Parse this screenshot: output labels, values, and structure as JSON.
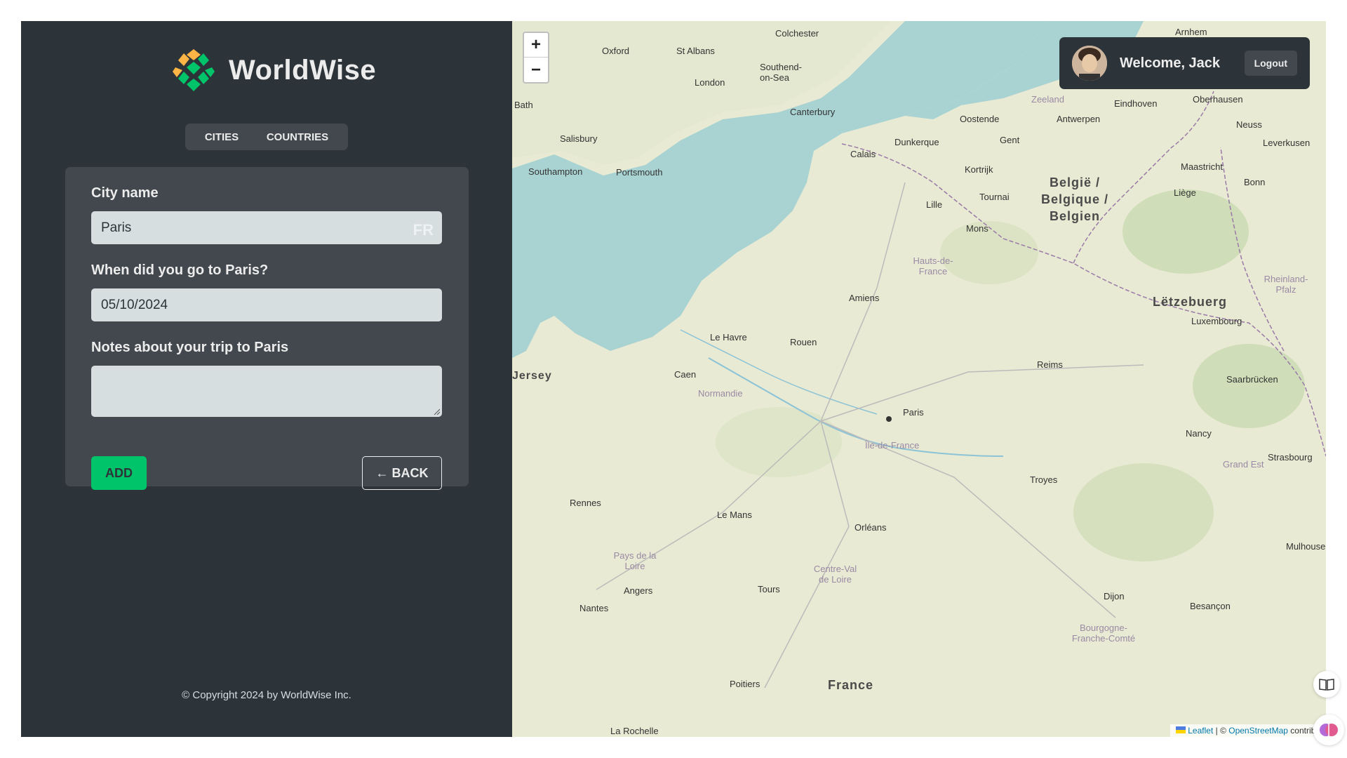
{
  "app": {
    "logo_text": "WorldWise",
    "tabs": [
      {
        "label": "Cities"
      },
      {
        "label": "Countries"
      }
    ],
    "copyright": "© Copyright 2024 by WorldWise Inc."
  },
  "form": {
    "city_label": "City name",
    "city_value": "Paris",
    "city_flag": "FR",
    "date_label": "When did you go to Paris?",
    "date_value": "05/10/2024",
    "notes_label": "Notes about your trip to Paris",
    "notes_value": "",
    "add_label": "Add",
    "back_label": "← BACK"
  },
  "map": {
    "zoom_in": "+",
    "zoom_out": "−",
    "user": {
      "welcome": "Welcome, Jack",
      "logout": "Logout"
    },
    "attribution": {
      "leaflet": "Leaflet",
      "sep": " | © ",
      "osm": "OpenStreetMap",
      "rest": " contribu"
    },
    "labels": [
      {
        "text": "Colchester",
        "type": "city"
      },
      {
        "text": "Oxford",
        "type": "city"
      },
      {
        "text": "St Albans",
        "type": "city"
      },
      {
        "text": "London",
        "type": "city"
      },
      {
        "text": "Southend-on-Sea",
        "type": "city"
      },
      {
        "text": "Canterbury",
        "type": "city"
      },
      {
        "text": "Bath",
        "type": "city"
      },
      {
        "text": "Salisbury",
        "type": "city"
      },
      {
        "text": "Southampton",
        "type": "city"
      },
      {
        "text": "Portsmouth",
        "type": "city"
      },
      {
        "text": "Calais",
        "type": "city"
      },
      {
        "text": "Dunkerque",
        "type": "city"
      },
      {
        "text": "Oostende",
        "type": "city"
      },
      {
        "text": "Gent",
        "type": "city"
      },
      {
        "text": "Antwerpen",
        "type": "city"
      },
      {
        "text": "Eindhoven",
        "type": "city"
      },
      {
        "text": "Kortrijk",
        "type": "city"
      },
      {
        "text": "Lille",
        "type": "city"
      },
      {
        "text": "Tournai",
        "type": "city"
      },
      {
        "text": "Mons",
        "type": "city"
      },
      {
        "text": "België / Belgique / Belgien",
        "type": "country"
      },
      {
        "text": "Maastricht",
        "type": "city"
      },
      {
        "text": "Liège",
        "type": "city"
      },
      {
        "text": "Bonn",
        "type": "city"
      },
      {
        "text": "Neuss",
        "type": "city"
      },
      {
        "text": "Leverkusen",
        "type": "city"
      },
      {
        "text": "Oberhausen",
        "type": "city"
      },
      {
        "text": "Arnhem",
        "type": "city"
      },
      {
        "text": "Lëtzebuerg",
        "type": "country"
      },
      {
        "text": "Luxembourg",
        "type": "city"
      },
      {
        "text": "Hauts-de-France",
        "type": "region"
      },
      {
        "text": "Amiens",
        "type": "city"
      },
      {
        "text": "Le Havre",
        "type": "city"
      },
      {
        "text": "Rouen",
        "type": "city"
      },
      {
        "text": "Caen",
        "type": "city"
      },
      {
        "text": "Normandie",
        "type": "region"
      },
      {
        "text": "Reims",
        "type": "city"
      },
      {
        "text": "Paris",
        "type": "city"
      },
      {
        "text": "Île-de-France",
        "type": "region"
      },
      {
        "text": "Saarbrücken",
        "type": "city"
      },
      {
        "text": "Nancy",
        "type": "city"
      },
      {
        "text": "Strasbourg",
        "type": "city"
      },
      {
        "text": "Grand Est",
        "type": "region"
      },
      {
        "text": "Troyes",
        "type": "city"
      },
      {
        "text": "Rennes",
        "type": "city"
      },
      {
        "text": "Le Mans",
        "type": "city"
      },
      {
        "text": "Orléans",
        "type": "city"
      },
      {
        "text": "Pays de la Loire",
        "type": "region"
      },
      {
        "text": "Centre-Val de Loire",
        "type": "region"
      },
      {
        "text": "Angers",
        "type": "city"
      },
      {
        "text": "Tours",
        "type": "city"
      },
      {
        "text": "Nantes",
        "type": "city"
      },
      {
        "text": "Dijon",
        "type": "city"
      },
      {
        "text": "Besançon",
        "type": "city"
      },
      {
        "text": "Bourgogne-Franche-Comté",
        "type": "region"
      },
      {
        "text": "Mulhouse",
        "type": "city"
      },
      {
        "text": "Poitiers",
        "type": "city"
      },
      {
        "text": "France",
        "type": "country"
      },
      {
        "text": "La Rochelle",
        "type": "city"
      },
      {
        "text": "Jersey",
        "type": "city"
      },
      {
        "text": "Zeeland",
        "type": "region"
      },
      {
        "text": "Rheinland-Pfalz",
        "type": "region"
      }
    ]
  },
  "colors": {
    "sidebar_bg": "#2d3439",
    "card_bg": "#42484d",
    "accent": "#00c46a",
    "input_bg": "#d6dee0",
    "sea": "#a9d3d3",
    "land": "#e8ead3"
  }
}
